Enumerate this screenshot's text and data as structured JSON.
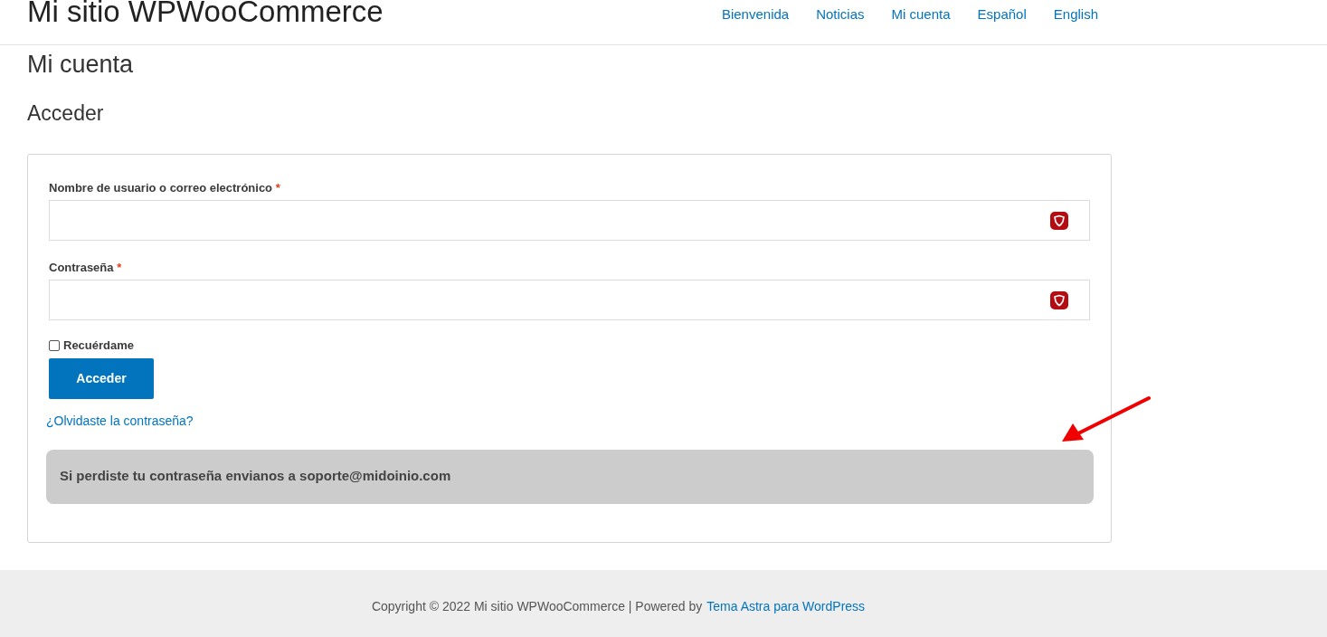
{
  "header": {
    "site_title": "Mi sitio WPWooCommerce",
    "nav": [
      {
        "label": "Bienvenida"
      },
      {
        "label": "Noticias"
      },
      {
        "label": "Mi cuenta"
      },
      {
        "label": "Español"
      },
      {
        "label": "English"
      }
    ]
  },
  "page_title": "Mi cuenta",
  "section_title": "Acceder",
  "form": {
    "fields": [
      {
        "label": "Nombre de usuario o correo electrónico",
        "required_mark": "*"
      },
      {
        "label": "Contraseña",
        "required_mark": "*"
      }
    ],
    "remember": {
      "label": "Recuérdame",
      "checked": false
    },
    "submit": "Acceder",
    "lost_password": "¿Olvidaste la contraseña?",
    "notice": "Si perdiste tu contraseña envianos a soporte@midoinio.com"
  },
  "footer": {
    "text": "Copyright © 2022 Mi sitio WPWooCommerce | Powered by",
    "link": "Tema Astra para WordPress"
  }
}
